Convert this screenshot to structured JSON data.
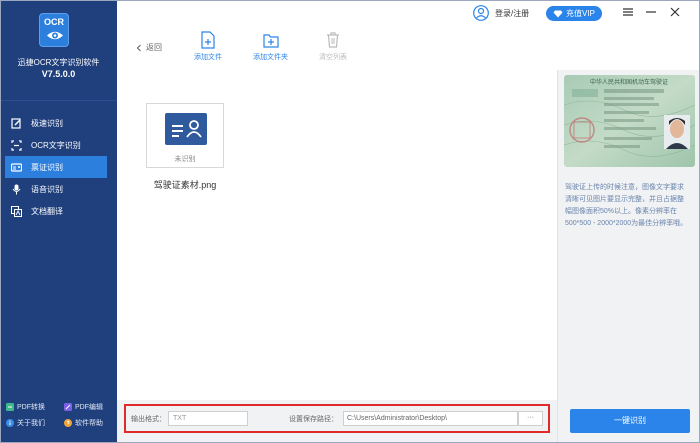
{
  "app": {
    "logo_text": "OCR",
    "title": "迅捷OCR文字识别软件",
    "version": "V7.5.0.0"
  },
  "sidebar": {
    "items": [
      {
        "label": "极速识别",
        "icon": "edit-icon",
        "active": false
      },
      {
        "label": "OCR文字识别",
        "icon": "scan-icon",
        "active": false
      },
      {
        "label": "票证识别",
        "icon": "card-icon",
        "active": true
      },
      {
        "label": "语音识别",
        "icon": "microphone-icon",
        "active": false
      },
      {
        "label": "文档翻译",
        "icon": "translate-icon",
        "active": false
      }
    ],
    "bottom_links": [
      {
        "label": "PDF转换",
        "icon": "pdf-convert-icon"
      },
      {
        "label": "PDF编辑",
        "icon": "pdf-edit-icon"
      },
      {
        "label": "关于我们",
        "icon": "info-icon"
      },
      {
        "label": "软件帮助",
        "icon": "help-icon"
      }
    ]
  },
  "topbar": {
    "login_label": "登录/注册",
    "vip_label": "充值VIP"
  },
  "toolbar": {
    "back_label": "返回",
    "add_file_label": "添加文件",
    "add_folder_label": "添加文件夹",
    "clear_list_label": "清空列表"
  },
  "file": {
    "status": "未识别",
    "name": "驾驶证素材.png"
  },
  "options": {
    "format_label": "输出格式：",
    "format_value": "TXT",
    "path_label": "设置保存路径：",
    "path_value": "C:\\Users\\Administrator\\Desktop\\",
    "browse_label": "···"
  },
  "right_panel": {
    "license_header": "中华人民共和国机动车驾驶证",
    "hint": "驾驶证上传的时候注意，图像文字要求清晰可见图片要显示完整，并且占据整幅图像面积50%以上。像素分辨率在500*500 - 2000*2000为最佳分辨率哦。",
    "recognize_label": "一键识别"
  },
  "colors": {
    "sidebar_bg": "#1f3f7d",
    "accent": "#2a84e9",
    "highlight_border": "#e02a2a"
  }
}
